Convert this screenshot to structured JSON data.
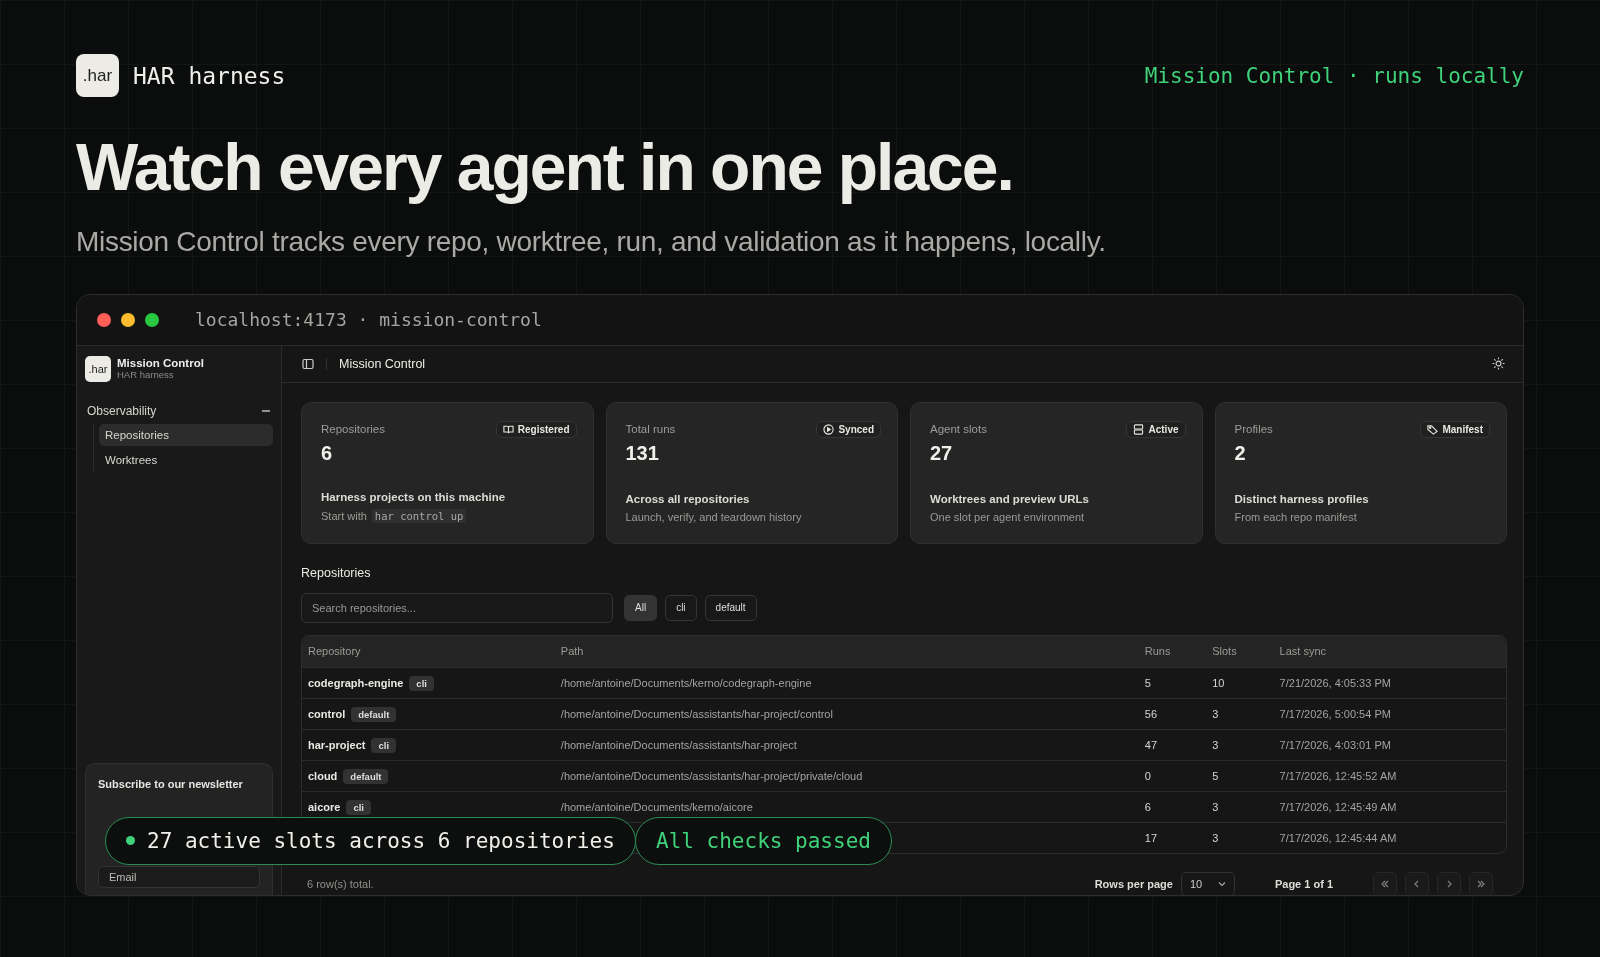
{
  "header": {
    "logo": ".har",
    "name": "HAR harness",
    "tagline": "Mission Control · runs locally"
  },
  "headline": "Watch every agent in one place.",
  "subtitle": "Mission Control tracks every repo, worktree, run, and validation as it happens, locally.",
  "browser": {
    "address": "localhost:4173 · mission-control"
  },
  "sidebar": {
    "logo": ".har",
    "app_name": "Mission Control",
    "app_subtitle": "HAR harness",
    "group": {
      "label": "Observability",
      "expanded": true,
      "items": [
        {
          "label": "Repositories",
          "selected": true
        },
        {
          "label": "Worktrees",
          "selected": false
        }
      ]
    },
    "newsletter": {
      "title": "Subscribe to our newsletter",
      "email_placeholder": "Email"
    }
  },
  "topbar": {
    "title": "Mission Control"
  },
  "stats": [
    {
      "label": "Repositories",
      "badge": "Registered",
      "kind": "book",
      "value": "6",
      "description": "Harness projects on this machine",
      "hint": "Start with",
      "hint_code": "har control up"
    },
    {
      "label": "Total runs",
      "badge": "Synced",
      "kind": "play",
      "value": "131",
      "description": "Across all repositories",
      "hint": "Launch, verify, and teardown history"
    },
    {
      "label": "Agent slots",
      "badge": "Active",
      "kind": "server",
      "value": "27",
      "description": "Worktrees and preview URLs",
      "hint": "One slot per agent environment"
    },
    {
      "label": "Profiles",
      "badge": "Manifest",
      "kind": "tag",
      "value": "2",
      "description": "Distinct harness profiles",
      "hint": "From each repo manifest"
    }
  ],
  "repositories": {
    "title": "Repositories",
    "search_placeholder": "Search repositories...",
    "filters": [
      {
        "label": "All",
        "selected": true
      },
      {
        "label": "cli",
        "selected": false
      },
      {
        "label": "default",
        "selected": false
      }
    ],
    "columns": [
      "Repository",
      "Path",
      "Runs",
      "Slots",
      "Last sync"
    ],
    "rows": [
      {
        "name": "codegraph-engine",
        "profile": "cli",
        "path": "/home/antoine/Documents/kerno/codegraph-engine",
        "runs": "5",
        "slots": "10",
        "last_sync": "7/21/2026, 4:05:33 PM"
      },
      {
        "name": "control",
        "profile": "default",
        "path": "/home/antoine/Documents/assistants/har-project/control",
        "runs": "56",
        "slots": "3",
        "last_sync": "7/17/2026, 5:00:54 PM"
      },
      {
        "name": "har-project",
        "profile": "cli",
        "path": "/home/antoine/Documents/assistants/har-project",
        "runs": "47",
        "slots": "3",
        "last_sync": "7/17/2026, 4:03:01 PM"
      },
      {
        "name": "cloud",
        "profile": "default",
        "path": "/home/antoine/Documents/assistants/har-project/private/cloud",
        "runs": "0",
        "slots": "5",
        "last_sync": "7/17/2026, 12:45:52 AM"
      },
      {
        "name": "aicore",
        "profile": "cli",
        "path": "/home/antoine/Documents/kerno/aicore",
        "runs": "6",
        "slots": "3",
        "last_sync": "7/17/2026, 12:45:49 AM"
      },
      {
        "runs": "17",
        "slots": "3",
        "last_sync": "7/17/2026, 12:45:44 AM"
      }
    ],
    "footer": "6 row(s) total.",
    "rows_per_page_label": "Rows per page",
    "rows_per_page": "10",
    "page": "Page 1 of 1"
  },
  "status": {
    "slots": "27 active slots across 6 repositories",
    "checks": "All checks passed"
  }
}
